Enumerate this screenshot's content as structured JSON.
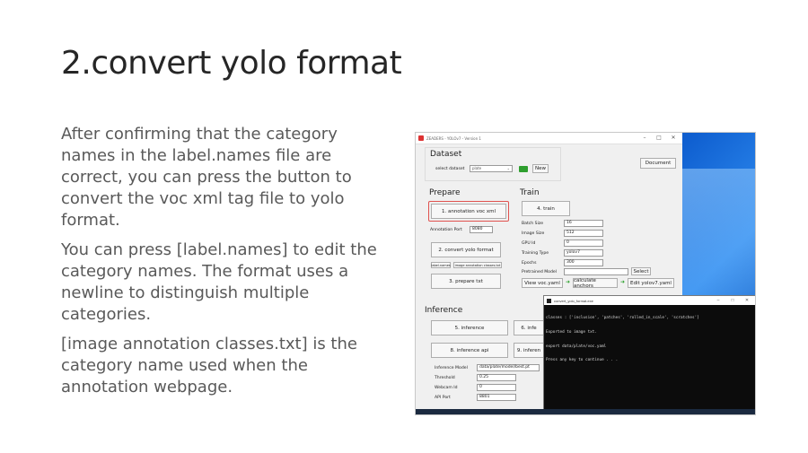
{
  "slide": {
    "title": "2.convert yolo format",
    "paragraphs": [
      "After confirming that the category names in the label.names file are correct, you can press the button to convert the voc xml tag file to yolo format.",
      "You can press [label.names] to edit the category names. The format uses a newline to distinguish multiple categories.",
      "[image annotation classes.txt] is the category name used when the annotation webpage."
    ]
  },
  "app": {
    "window_title": "ZEADERS - YOLOv7 - Version 1",
    "window_buttons": [
      "–",
      "□",
      "✕"
    ],
    "dataset": {
      "heading": "Dataset",
      "select_label": "select dataset",
      "select_value": "plate",
      "new_button": "New",
      "document_button": "Document"
    },
    "prepare": {
      "heading": "Prepare",
      "annotation_button": "1. annotation voc xml",
      "port_label": "Annotation Port",
      "port_value": "8080",
      "convert_button": "2. convert yolo format",
      "label_names_button": "label.names",
      "classes_button": "image annotation classes.txt",
      "prepare_button": "3. prepare txt"
    },
    "train": {
      "heading": "Train",
      "train_button": "4. train",
      "fields": [
        {
          "label": "Batch Size",
          "value": "16"
        },
        {
          "label": "Image Size",
          "value": "512"
        },
        {
          "label": "GPU Id",
          "value": "0"
        },
        {
          "label": "Training Type",
          "value": "yolov7"
        },
        {
          "label": "Epochs",
          "value": "300"
        }
      ],
      "pretrained_label": "Pretrained Model",
      "pretrained_value": "",
      "select_button": "Select",
      "view_voc_button": "View voc.yaml",
      "anchors_button": "calculate anchors",
      "edit_yaml_button": "Edit yolov7.yaml"
    },
    "inference": {
      "heading": "Inference",
      "inference_button": "5. inference",
      "inference_button_2": "6. infe",
      "api_button": "8. inference api",
      "api_button_2": "9. inferen",
      "fields": [
        {
          "label": "Inference Model",
          "value": "data/plate/model/best.pt"
        },
        {
          "label": "Threshold",
          "value": "0.25"
        },
        {
          "label": "Webcam Id",
          "value": "0"
        },
        {
          "label": "API Port",
          "value": "8801"
        }
      ]
    }
  },
  "console": {
    "title": "convert_yolo_format.exe",
    "lines": [
      "classes : ['inclusion', 'patches', 'rolled_in_scale', 'scratches']",
      "Exported to image txt.",
      "export data/plate/voc.yaml",
      "Press any key to continue . . ."
    ]
  },
  "colors": {
    "highlight": "#e0524f",
    "arrow": "#2aa02a",
    "desktop": "#0f5fd0"
  }
}
